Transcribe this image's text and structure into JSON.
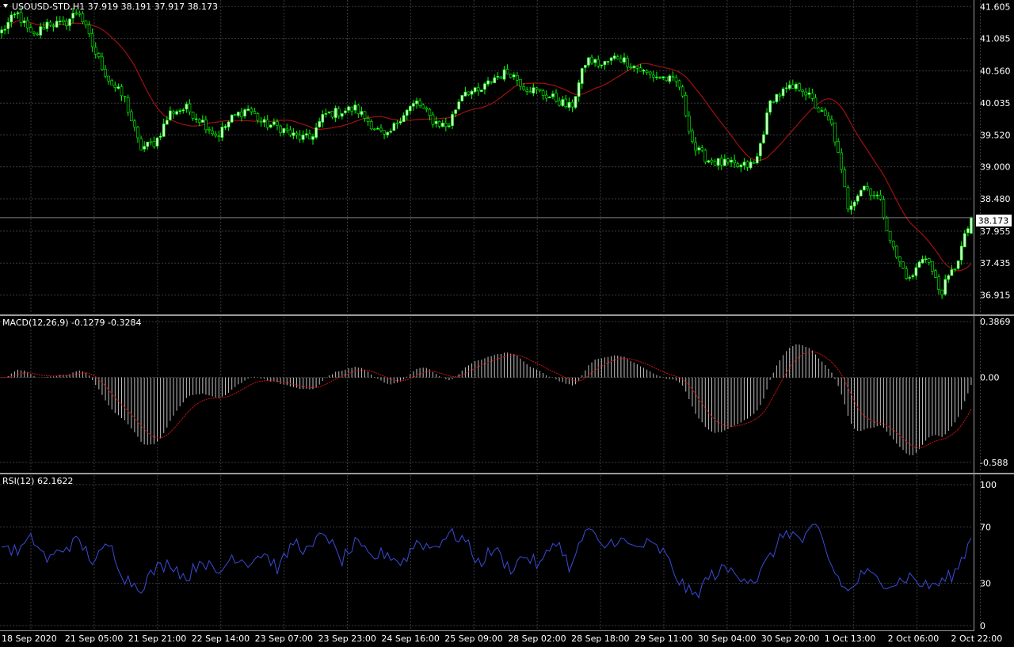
{
  "symbol_header": "USOUSD-STD,H1  37.919 38.191 37.917 38.173",
  "current_price_label": "38.173",
  "colors": {
    "background": "#000000",
    "grid": "#3a3a3a",
    "candle_bull": "#ccffcc",
    "candle_bear": "#000000",
    "candle_wick": "#00ff00",
    "ma": "#a01010",
    "macd_hist": "#c0c0c0",
    "macd_signal": "#cc1111",
    "rsi": "#3b4bd8",
    "axis_text": "#ffffff"
  },
  "chart_data": [
    {
      "type": "candlestick",
      "name": "price",
      "ylim": [
        36.64,
        41.66
      ],
      "y_ticks": [
        "41.605",
        "41.085",
        "40.560",
        "40.035",
        "39.520",
        "39.000",
        "38.480",
        "37.955",
        "37.435",
        "36.915"
      ],
      "y_tick_values": [
        41.605,
        41.085,
        40.56,
        40.035,
        39.52,
        39.0,
        38.48,
        37.955,
        37.435,
        36.915
      ],
      "current_price": 38.173,
      "keypoints": [
        41.2,
        41.5,
        41.1,
        41.35,
        41.3,
        41.55,
        40.9,
        40.4,
        40.1,
        39.3,
        39.4,
        39.9,
        39.95,
        39.75,
        39.5,
        39.8,
        39.95,
        39.7,
        39.65,
        39.5,
        39.45,
        39.85,
        39.9,
        39.95,
        39.7,
        39.45,
        39.85,
        40.05,
        39.75,
        39.65,
        40.25,
        40.2,
        40.45,
        40.55,
        40.3,
        40.2,
        40.1,
        39.95,
        40.75,
        40.65,
        40.8,
        40.65,
        40.5,
        40.45,
        40.35,
        39.3,
        39.1,
        39.05,
        39.0,
        39.05,
        40.1,
        40.25,
        40.3,
        39.95,
        39.65,
        38.35,
        38.7,
        38.5,
        37.6,
        37.15,
        37.6,
        36.95,
        37.4,
        38.173
      ],
      "ma_period": 20
    },
    {
      "type": "histogram",
      "name": "MACD",
      "title": "MACD(12,26,9) -0.1279 -0.3284",
      "ylim": [
        -0.655,
        0.41
      ],
      "y_ticks": [
        "0.3869",
        "0.00",
        "-0.588"
      ],
      "y_tick_values": [
        0.3869,
        0.0,
        -0.588
      ],
      "last_values": {
        "macd": -0.1279,
        "signal": -0.3284
      }
    },
    {
      "type": "line",
      "name": "RSI",
      "title": "RSI(12) 62.1622",
      "ylim": [
        0,
        100
      ],
      "y_ticks": [
        "100",
        "70",
        "30",
        "0"
      ],
      "y_tick_values": [
        100,
        70,
        30,
        0
      ],
      "last_value": 62.1622,
      "keypoints": [
        58,
        52,
        62,
        46,
        55,
        60,
        45,
        58,
        34,
        27,
        40,
        45,
        33,
        48,
        35,
        50,
        45,
        52,
        40,
        60,
        52,
        68,
        45,
        58,
        48,
        52,
        44,
        60,
        55,
        65,
        62,
        44,
        55,
        40,
        50,
        42,
        62,
        40,
        70,
        55,
        62,
        55,
        58,
        52,
        32,
        20,
        35,
        40,
        36,
        32,
        50,
        68,
        60,
        70,
        40,
        23,
        38,
        32,
        30,
        35,
        28,
        30,
        38,
        62
      ]
    }
  ],
  "x_labels": [
    "18 Sep 2020",
    "21 Sep 05:00",
    "21 Sep 21:00",
    "22 Sep 14:00",
    "23 Sep 07:00",
    "23 Sep 23:00",
    "24 Sep 16:00",
    "25 Sep 09:00",
    "28 Sep 02:00",
    "28 Sep 18:00",
    "29 Sep 11:00",
    "30 Sep 04:00",
    "30 Sep 20:00",
    "1 Oct 13:00",
    "2 Oct 06:00",
    "2 Oct 22:00"
  ]
}
